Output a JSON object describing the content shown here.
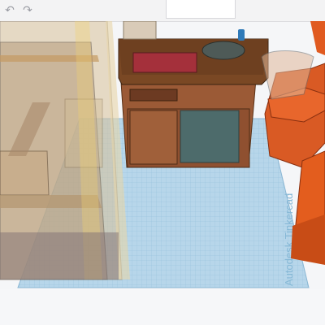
{
  "toolbar": {
    "undo_icon": "undo-icon",
    "redo_icon": "redo-icon",
    "redo_glyph": "↷",
    "undo_glyph": "↶"
  },
  "workplane": {
    "watermark": "Autodesk Tinkercad",
    "grid_color": "#7fb3d4"
  },
  "colors": {
    "cabinet": "#8b4d2e",
    "countertop": "#5e3a1f",
    "sink_mat": "#a8303a",
    "orange_box": "#e05a1a",
    "glass": "#e8cfa0"
  }
}
